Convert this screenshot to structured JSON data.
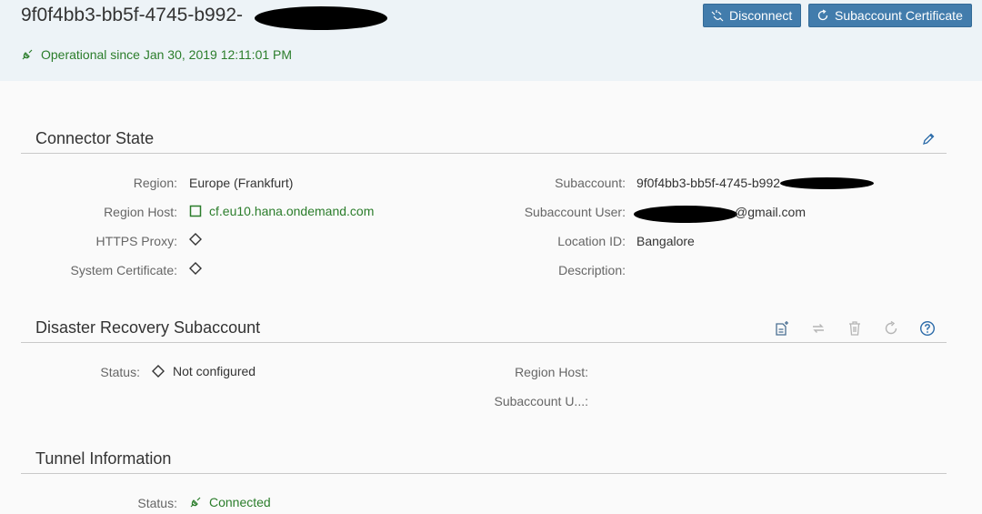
{
  "header": {
    "title": "9f0f4bb3-bb5f-4745-b992-",
    "operational_status": "Operational since Jan 30, 2019 12:11:01 PM",
    "disconnect_label": "Disconnect",
    "subaccount_certificate_label": "Subaccount Certificate"
  },
  "connector_state": {
    "title": "Connector State",
    "region_label": "Region:",
    "region_value": "Europe (Frankfurt)",
    "region_host_label": "Region Host:",
    "region_host_value": "cf.eu10.hana.ondemand.com",
    "https_proxy_label": "HTTPS Proxy:",
    "system_certificate_label": "System Certificate:",
    "subaccount_label": "Subaccount:",
    "subaccount_value": "9f0f4bb3-bb5f-4745-b992",
    "subaccount_user_label": "Subaccount User:",
    "subaccount_user_value": "@gmail.com",
    "location_id_label": "Location ID:",
    "location_id_value": "Bangalore",
    "description_label": "Description:"
  },
  "disaster_recovery": {
    "title": "Disaster Recovery Subaccount",
    "status_label": "Status:",
    "status_value": "Not configured",
    "region_host_label": "Region Host:",
    "subaccount_user_label": "Subaccount U...:"
  },
  "tunnel": {
    "title": "Tunnel Information",
    "status_label": "Status:",
    "status_value": "Connected"
  },
  "colors": {
    "accent": "#427cac",
    "success": "#2b7d2b",
    "header_bg": "#edf3f7"
  },
  "icons": {
    "connected": "plug-connected-icon",
    "disconnect": "plug-disconnect-icon",
    "certificate": "refresh-icon",
    "edit": "pencil-icon",
    "not_configured": "diamond-icon",
    "host": "square-icon"
  }
}
